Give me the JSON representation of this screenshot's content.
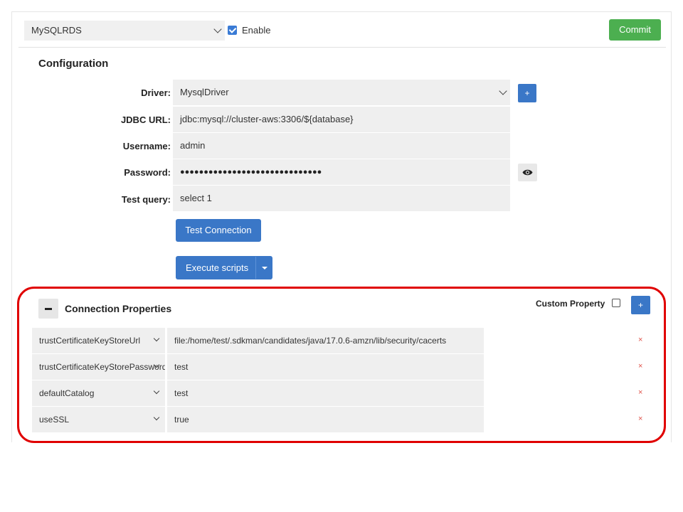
{
  "datasource": {
    "selected": "MySQLRDS"
  },
  "enable": {
    "label": "Enable",
    "checked": true
  },
  "commit_label": "Commit",
  "configuration": {
    "title": "Configuration",
    "fields": [
      {
        "label": "Driver:",
        "value": "MysqlDriver"
      },
      {
        "label": "JDBC URL:",
        "value": "jdbc:mysql://cluster-aws:3306/${database}"
      },
      {
        "label": "Username:",
        "value": "admin"
      },
      {
        "label": "Password:",
        "value": "●●●●●●●●●●●●●●●●●●●●●●●●●●●●●●"
      },
      {
        "label": "Test query:",
        "value": "select 1"
      }
    ],
    "add_driver_label": "+",
    "test_connection_label": "Test Connection",
    "execute_scripts_label": "Execute scripts"
  },
  "connection_properties": {
    "title": "Connection Properties",
    "custom_property_label": "Custom Property",
    "add_label": "+",
    "delete_label": "×",
    "rows": [
      {
        "key": "trustCertificateKeyStoreUrl",
        "value": "file:/home/test/.sdkman/candidates/java/17.0.6-amzn/lib/security/cacerts"
      },
      {
        "key": "trustCertificateKeyStorePassword",
        "value": "test"
      },
      {
        "key": "defaultCatalog",
        "value": "test"
      },
      {
        "key": "useSSL",
        "value": "true"
      }
    ]
  },
  "colors": {
    "accent": "#3a77c7",
    "commit": "#4caf50",
    "highlight": "#e00000",
    "delete": "#e0534a"
  }
}
